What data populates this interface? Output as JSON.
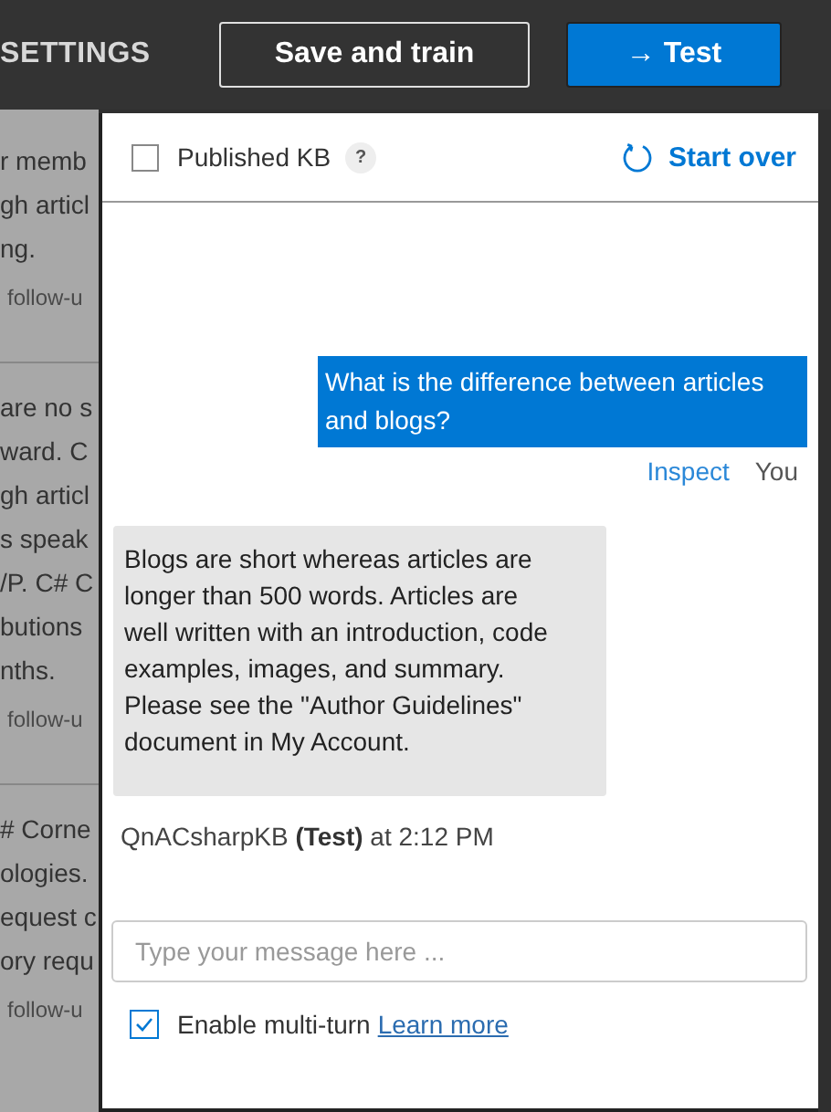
{
  "header": {
    "section_label": "SETTINGS",
    "buttons": [
      {
        "label": "Save and train",
        "kind": "outline"
      },
      {
        "label": "Test",
        "kind": "primary",
        "icon": "→"
      }
    ]
  },
  "background_list": {
    "items": [
      {
        "lines": [
          "r memb",
          "gh articl",
          "ng."
        ],
        "link": "follow-u"
      },
      {
        "lines": [
          "are no s",
          "ward. C",
          "gh articl",
          "s speak",
          "/P. C# C",
          "butions",
          "nths."
        ],
        "link": "follow-u"
      },
      {
        "lines": [
          "# Corne",
          "ologies.",
          "equest c",
          "ory requ"
        ],
        "link": "follow-u"
      }
    ]
  },
  "test_panel": {
    "published_kb": {
      "label": "Published KB",
      "checked": false,
      "help": "?"
    },
    "start_over": "Start over",
    "messages": [
      {
        "kind": "user",
        "text": "What is the difference between articles and blogs?",
        "action": "Inspect",
        "author": "You"
      },
      {
        "kind": "bot",
        "text": "Blogs are short whereas articles are longer than 500 words. Articles are well written with an introduction, code examples, images, and summary. Please see the \"Author Guidelines\" document in My Account.",
        "footer": "QnACsharpKB **(Test)** at 2:12 PM"
      }
    ],
    "input": {
      "placeholder": "Type your message here ..."
    },
    "multi_turn": {
      "label": "Enable multi-turn",
      "link": "Learn more",
      "checked": true
    }
  }
}
